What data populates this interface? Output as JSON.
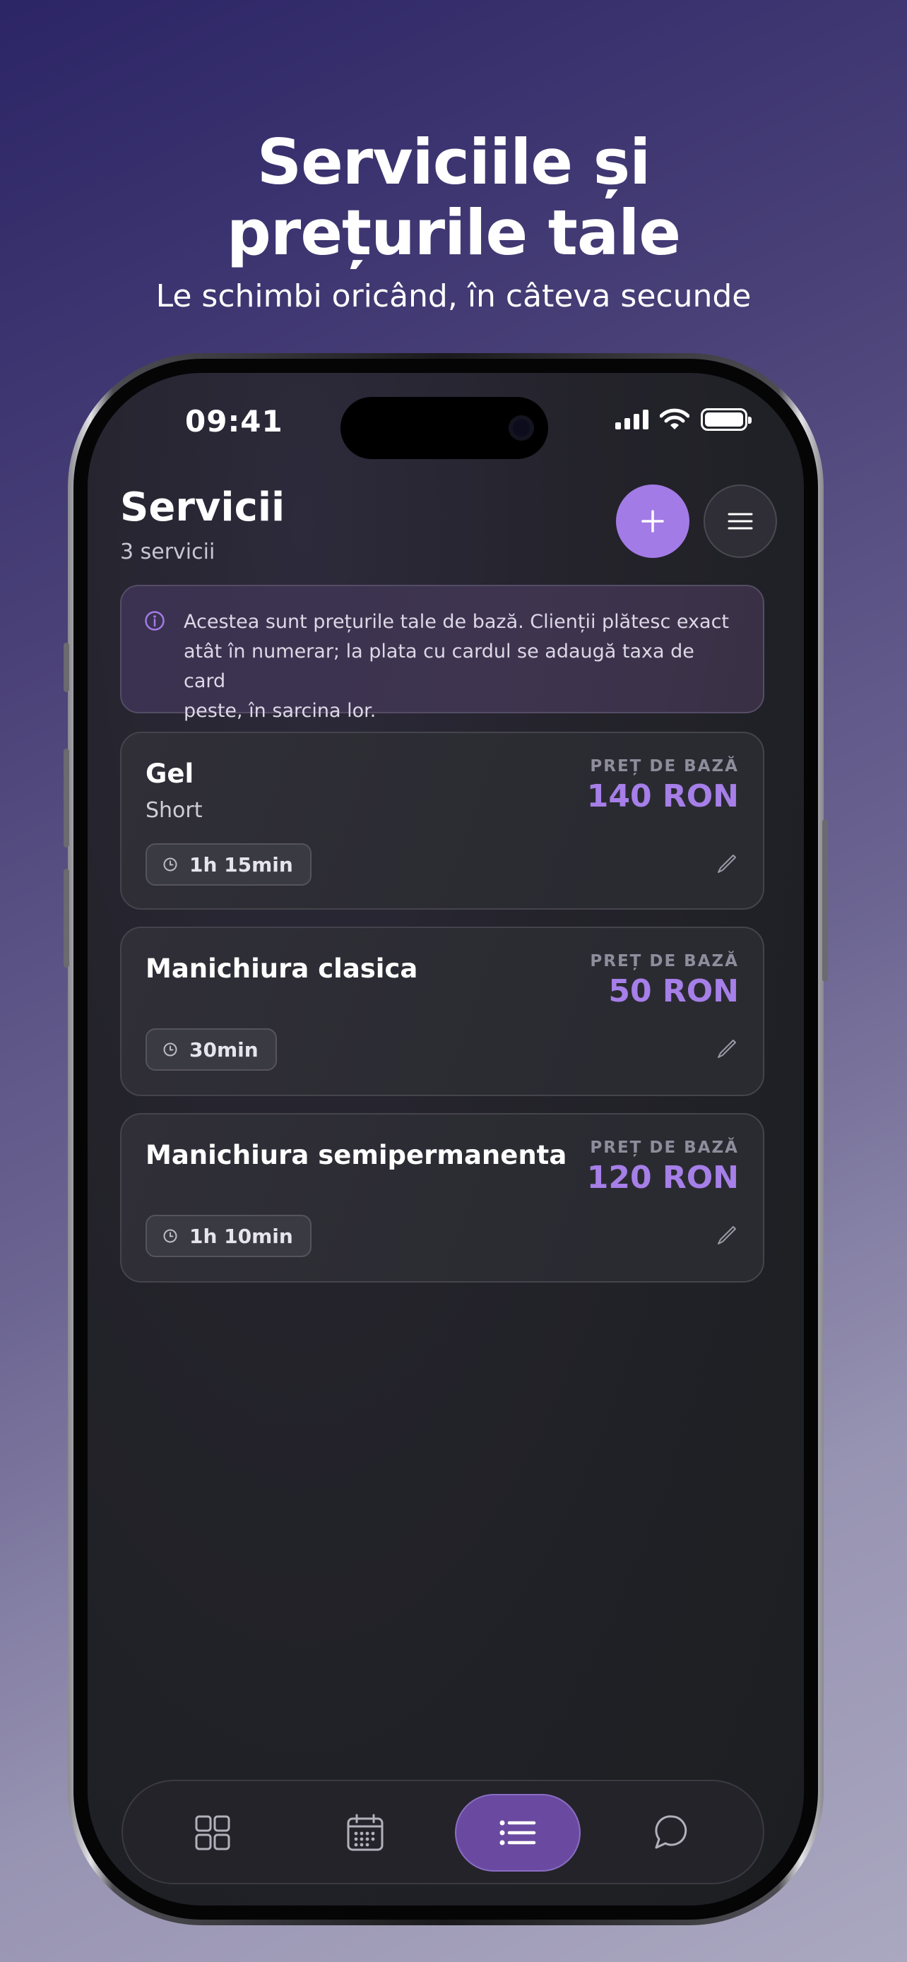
{
  "hero": {
    "title_line1": "Serviciile și",
    "title_line2": "prețurile tale",
    "subtitle": "Le schimbi oricând, în câteva secunde"
  },
  "status_bar": {
    "time": "09:41"
  },
  "header": {
    "title": "Servicii",
    "count": "3 servicii",
    "add_icon": "plus-icon",
    "menu_icon": "hamburger-menu-icon"
  },
  "info": {
    "icon": "info-icon",
    "line1": "Acestea sunt prețurile tale de bază. Clienții plătesc exact",
    "line2": "atât în numerar; la plata cu cardul se adaugă taxa de card",
    "line3": "peste, în sarcina lor."
  },
  "services": [
    {
      "name": "Gel",
      "variant": "Short",
      "price_label": "PREȚ DE BAZĂ",
      "price": "140 RON",
      "duration": "1h 15min"
    },
    {
      "name": "Manichiura clasica",
      "variant": "",
      "price_label": "PREȚ DE BAZĂ",
      "price": "50 RON",
      "duration": "30min"
    },
    {
      "name": "Manichiura semipermanenta",
      "variant": "",
      "price_label": "PREȚ DE BAZĂ",
      "price": "120 RON",
      "duration": "1h 10min"
    }
  ],
  "tabbar": {
    "tabs": [
      {
        "icon": "grid-icon",
        "active": false
      },
      {
        "icon": "calendar-icon",
        "active": false
      },
      {
        "icon": "list-icon",
        "active": true
      },
      {
        "icon": "chat-icon",
        "active": false
      }
    ]
  },
  "colors": {
    "accent": "#a37be6",
    "price": "#a67fe8",
    "active_tab": "#6a4aa0"
  }
}
